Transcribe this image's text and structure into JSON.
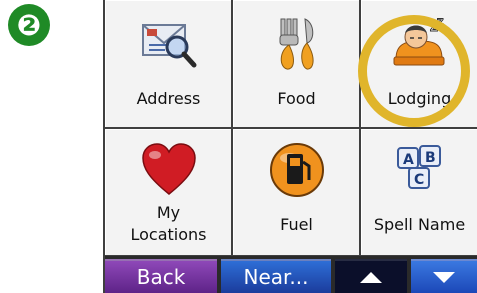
{
  "step_badge": "❷",
  "tiles": [
    {
      "label": "Address",
      "icon": "address-envelope-magnifier-icon"
    },
    {
      "label": "Food",
      "icon": "fork-knife-food-icon"
    },
    {
      "label": "Lodging",
      "icon": "sleeping-person-lodging-icon"
    },
    {
      "label_line1": "My",
      "label_line2": "Locations",
      "icon": "heart-icon"
    },
    {
      "label": "Fuel",
      "icon": "fuel-pump-icon"
    },
    {
      "label": "Spell Name",
      "icon": "abc-blocks-icon"
    }
  ],
  "bottom_bar": {
    "back_label": "Back",
    "near_label": "Near...",
    "up_icon": "scroll-up-icon",
    "down_icon": "scroll-down-icon"
  },
  "colors": {
    "badge": "#1f8a26",
    "highlight_ring": "#e0b52b",
    "back_button": "#7a38a8",
    "near_button": "#2458c0",
    "up_button": "#0b0f2a",
    "down_button": "#2c60cc"
  }
}
